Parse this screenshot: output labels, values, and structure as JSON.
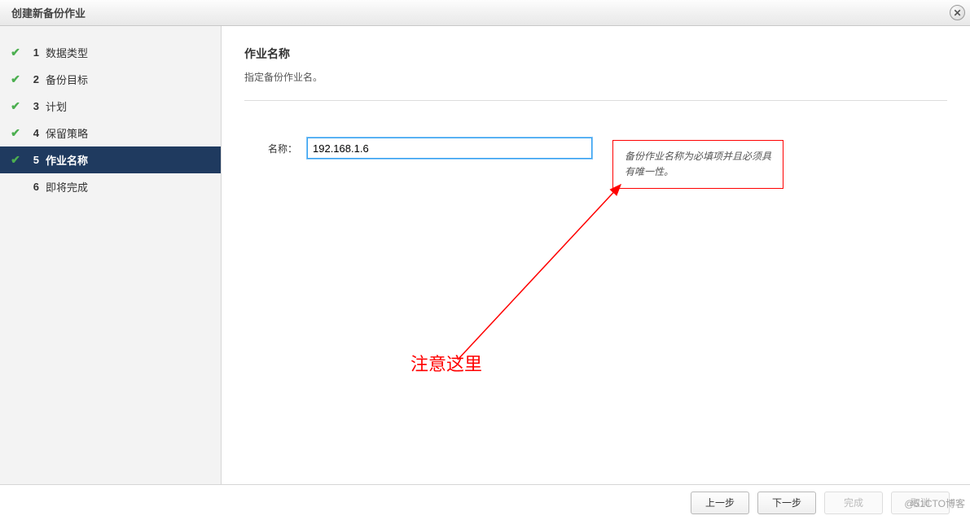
{
  "window": {
    "title": "创建新备份作业",
    "close_symbol": "✕"
  },
  "sidebar": {
    "steps": [
      {
        "num": "1",
        "label": "数据类型",
        "done": true
      },
      {
        "num": "2",
        "label": "备份目标",
        "done": true
      },
      {
        "num": "3",
        "label": "计划",
        "done": true
      },
      {
        "num": "4",
        "label": "保留策略",
        "done": true
      },
      {
        "num": "5",
        "label": "作业名称",
        "done": true,
        "active": true
      },
      {
        "num": "6",
        "label": "即将完成",
        "done": false
      }
    ]
  },
  "main": {
    "heading": "作业名称",
    "subtitle": "指定备份作业名。",
    "name_label": "名称：",
    "name_value": "192.168.1.6",
    "hint": "备份作业名称为必填项并且必须具有唯一性。"
  },
  "annotation": {
    "label": "注意这里"
  },
  "footer": {
    "prev": "上一步",
    "next": "下一步",
    "finish": "完成",
    "cancel": "取消"
  },
  "watermark": "@51CTO博客"
}
